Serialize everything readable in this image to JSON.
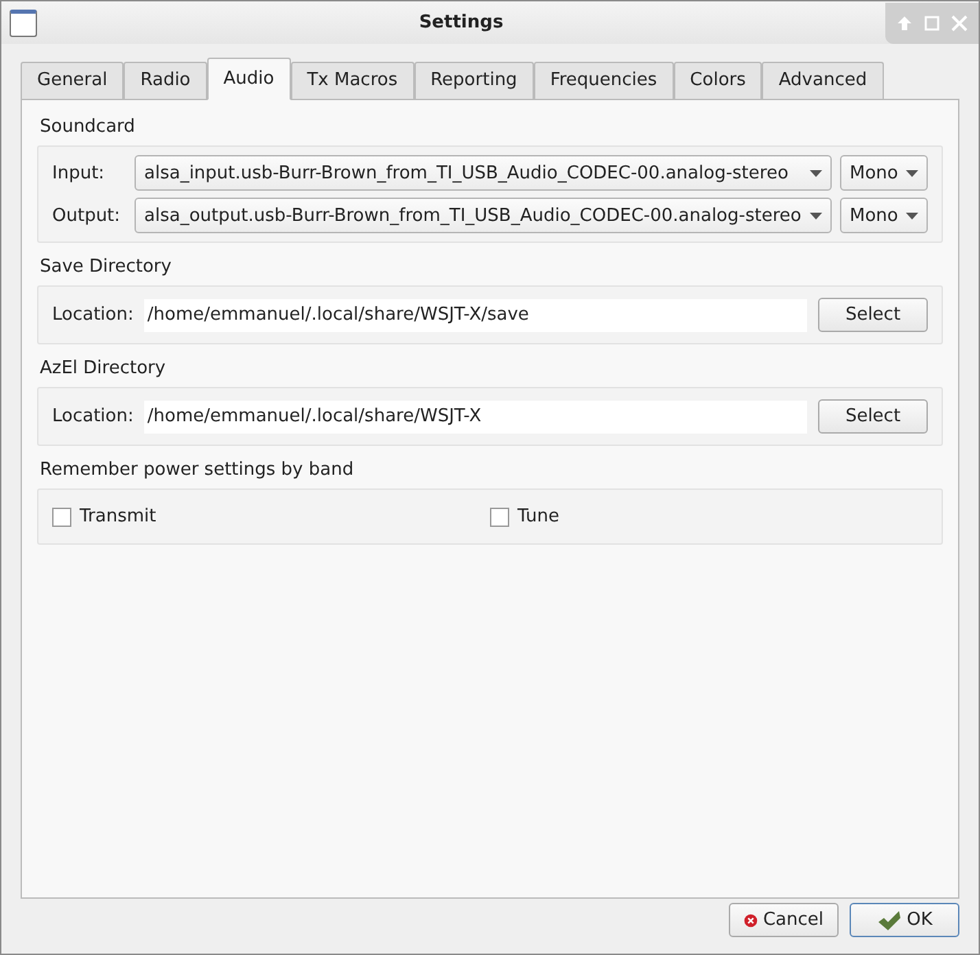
{
  "window": {
    "title": "Settings"
  },
  "tabs": [
    {
      "label": "General",
      "selected": false
    },
    {
      "label": "Radio",
      "selected": false
    },
    {
      "label": "Audio",
      "selected": true
    },
    {
      "label": "Tx Macros",
      "selected": false
    },
    {
      "label": "Reporting",
      "selected": false
    },
    {
      "label": "Frequencies",
      "selected": false
    },
    {
      "label": "Colors",
      "selected": false
    },
    {
      "label": "Advanced",
      "selected": false
    }
  ],
  "soundcard": {
    "title": "Soundcard",
    "rows": [
      {
        "label": "Input:",
        "device": "alsa_input.usb-Burr-Brown_from_TI_USB_Audio_CODEC-00.analog-stereo",
        "channel": "Mono"
      },
      {
        "label": "Output:",
        "device": "alsa_output.usb-Burr-Brown_from_TI_USB_Audio_CODEC-00.analog-stereo",
        "channel": "Mono"
      }
    ]
  },
  "directories": [
    {
      "title": "Save Directory",
      "label": "Location:",
      "value": "/home/emmanuel/.local/share/WSJT-X/save",
      "button": "Select"
    },
    {
      "title": "AzEl Directory",
      "label": "Location:",
      "value": "/home/emmanuel/.local/share/WSJT-X",
      "button": "Select"
    }
  ],
  "power": {
    "title": "Remember power settings by band",
    "options": [
      {
        "label": "Transmit",
        "checked": false
      },
      {
        "label": "Tune",
        "checked": false
      }
    ]
  },
  "buttons": [
    {
      "kind": "cancel",
      "label": "Cancel"
    },
    {
      "kind": "ok",
      "label": "OK"
    }
  ]
}
